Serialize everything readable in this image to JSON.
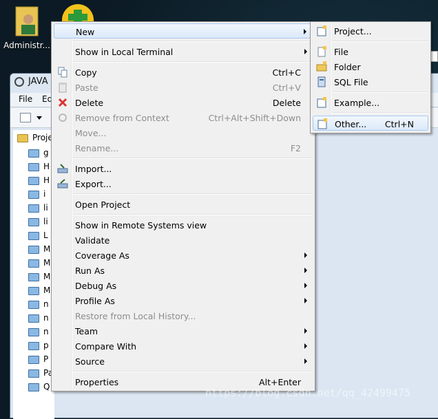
{
  "desktop": {
    "icon1_label": "Administr..."
  },
  "window": {
    "title": "JAVA",
    "menubar": [
      "File",
      "Ed"
    ],
    "tree_header": "Proje",
    "tree_items": [
      "g",
      "H",
      "H",
      "i",
      "li",
      "li",
      "L",
      "M",
      "M",
      "M",
      "M",
      "n",
      "n",
      "n",
      "p",
      "P",
      "PactyPac",
      "Q ITOffer"
    ]
  },
  "context_menu": {
    "items": [
      {
        "label": "New",
        "shortcut": "",
        "submenu": true,
        "disabled": false,
        "icon": "",
        "highlighted": true
      },
      {
        "label": "Show in Local Terminal",
        "shortcut": "",
        "submenu": true,
        "disabled": false,
        "icon": ""
      },
      {
        "label": "Copy",
        "shortcut": "Ctrl+C",
        "submenu": false,
        "disabled": false,
        "icon": "copy-icon"
      },
      {
        "label": "Paste",
        "shortcut": "Ctrl+V",
        "submenu": false,
        "disabled": true,
        "icon": "paste-icon"
      },
      {
        "label": "Delete",
        "shortcut": "Delete",
        "submenu": false,
        "disabled": false,
        "icon": "delete-icon"
      },
      {
        "label": "Remove from Context",
        "shortcut": "Ctrl+Alt+Shift+Down",
        "submenu": false,
        "disabled": true,
        "icon": "remove-context-icon"
      },
      {
        "label": "Move...",
        "shortcut": "",
        "submenu": false,
        "disabled": true,
        "icon": ""
      },
      {
        "label": "Rename...",
        "shortcut": "F2",
        "submenu": false,
        "disabled": true,
        "icon": ""
      },
      {
        "label": "Import...",
        "shortcut": "",
        "submenu": false,
        "disabled": false,
        "icon": "import-icon"
      },
      {
        "label": "Export...",
        "shortcut": "",
        "submenu": false,
        "disabled": false,
        "icon": "export-icon"
      },
      {
        "label": "Open Project",
        "shortcut": "",
        "submenu": false,
        "disabled": false,
        "icon": ""
      },
      {
        "label": "Show in Remote Systems view",
        "shortcut": "",
        "submenu": false,
        "disabled": false,
        "icon": ""
      },
      {
        "label": "Validate",
        "shortcut": "",
        "submenu": false,
        "disabled": false,
        "icon": ""
      },
      {
        "label": "Coverage As",
        "shortcut": "",
        "submenu": true,
        "disabled": false,
        "icon": ""
      },
      {
        "label": "Run As",
        "shortcut": "",
        "submenu": true,
        "disabled": false,
        "icon": ""
      },
      {
        "label": "Debug As",
        "shortcut": "",
        "submenu": true,
        "disabled": false,
        "icon": ""
      },
      {
        "label": "Profile As",
        "shortcut": "",
        "submenu": true,
        "disabled": false,
        "icon": ""
      },
      {
        "label": "Restore from Local History...",
        "shortcut": "",
        "submenu": false,
        "disabled": true,
        "icon": ""
      },
      {
        "label": "Team",
        "shortcut": "",
        "submenu": true,
        "disabled": false,
        "icon": ""
      },
      {
        "label": "Compare With",
        "shortcut": "",
        "submenu": true,
        "disabled": false,
        "icon": ""
      },
      {
        "label": "Source",
        "shortcut": "",
        "submenu": true,
        "disabled": false,
        "icon": ""
      },
      {
        "label": "Properties",
        "shortcut": "Alt+Enter",
        "submenu": false,
        "disabled": false,
        "icon": ""
      }
    ]
  },
  "submenu": {
    "items": [
      {
        "label": "Project...",
        "shortcut": "",
        "icon": "new-project-icon"
      },
      {
        "label": "File",
        "shortcut": "",
        "icon": "new-file-icon"
      },
      {
        "label": "Folder",
        "shortcut": "",
        "icon": "new-folder-icon"
      },
      {
        "label": "SQL File",
        "shortcut": "",
        "icon": "sql-file-icon"
      },
      {
        "label": "Example...",
        "shortcut": "",
        "icon": "new-example-icon"
      },
      {
        "label": "Other...",
        "shortcut": "Ctrl+N",
        "icon": "new-other-icon",
        "highlighted": true
      }
    ]
  },
  "watermark": "https://blog.csdn.net/qq_42499475",
  "colors": {
    "menu_bg": "#f0f0f0",
    "highlight_border": "#a8c8ef",
    "disabled_text": "#8d8d8d"
  }
}
